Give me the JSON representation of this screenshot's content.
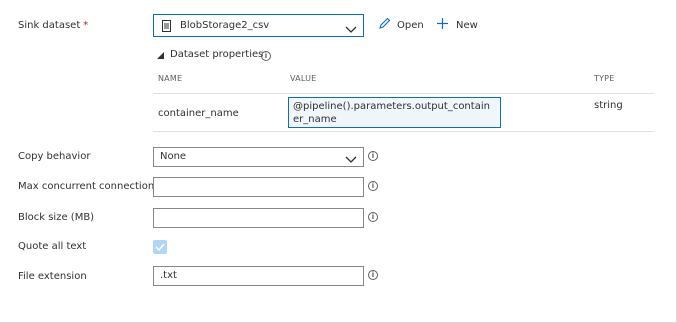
{
  "sink_dataset": {
    "label": "Sink dataset",
    "required_mark": "*",
    "selected": "BlobStorage2_csv",
    "open_label": "Open",
    "new_label": "New"
  },
  "dataset_properties": {
    "title": "Dataset properties",
    "columns": {
      "name": "NAME",
      "value": "VALUE",
      "type": "TYPE"
    },
    "rows": [
      {
        "name": "container_name",
        "value": "@pipeline().parameters.output_container_name",
        "type": "string"
      }
    ]
  },
  "copy_behavior": {
    "label": "Copy behavior",
    "value": "None"
  },
  "max_concurrent_connections": {
    "label": "Max concurrent connections",
    "value": ""
  },
  "block_size": {
    "label": "Block size (MB)",
    "value": ""
  },
  "quote_all_text": {
    "label": "Quote all text",
    "checked": true
  },
  "file_extension": {
    "label": "File extension",
    "value": ".txt"
  },
  "colors": {
    "accent": "#0f6cbd",
    "checkbox_fill": "#b3d6f2",
    "required": "#a4262c"
  }
}
